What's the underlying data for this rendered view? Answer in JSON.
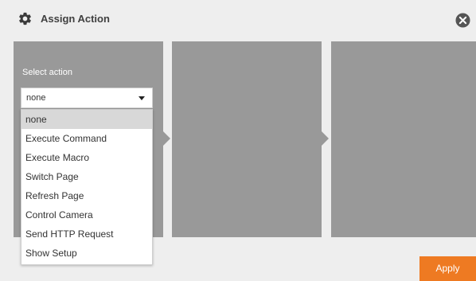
{
  "dialog": {
    "title": "Assign Action",
    "header_icon": "gear-icon",
    "close_icon": "close-icon"
  },
  "panels": {
    "first": {
      "label": "Select action"
    }
  },
  "action_select": {
    "value": "none",
    "options": [
      {
        "label": "none",
        "selected": true
      },
      {
        "label": "Execute Command",
        "selected": false
      },
      {
        "label": "Execute Macro",
        "selected": false
      },
      {
        "label": "Switch Page",
        "selected": false
      },
      {
        "label": "Refresh Page",
        "selected": false
      },
      {
        "label": "Control Camera",
        "selected": false
      },
      {
        "label": "Send HTTP Request",
        "selected": false
      },
      {
        "label": "Show Setup",
        "selected": false
      }
    ]
  },
  "footer": {
    "apply_label": "Apply"
  },
  "colors": {
    "background": "#eeeeee",
    "panel": "#999999",
    "accent": "#ee7a22",
    "selected_option": "#d8d8d8"
  }
}
